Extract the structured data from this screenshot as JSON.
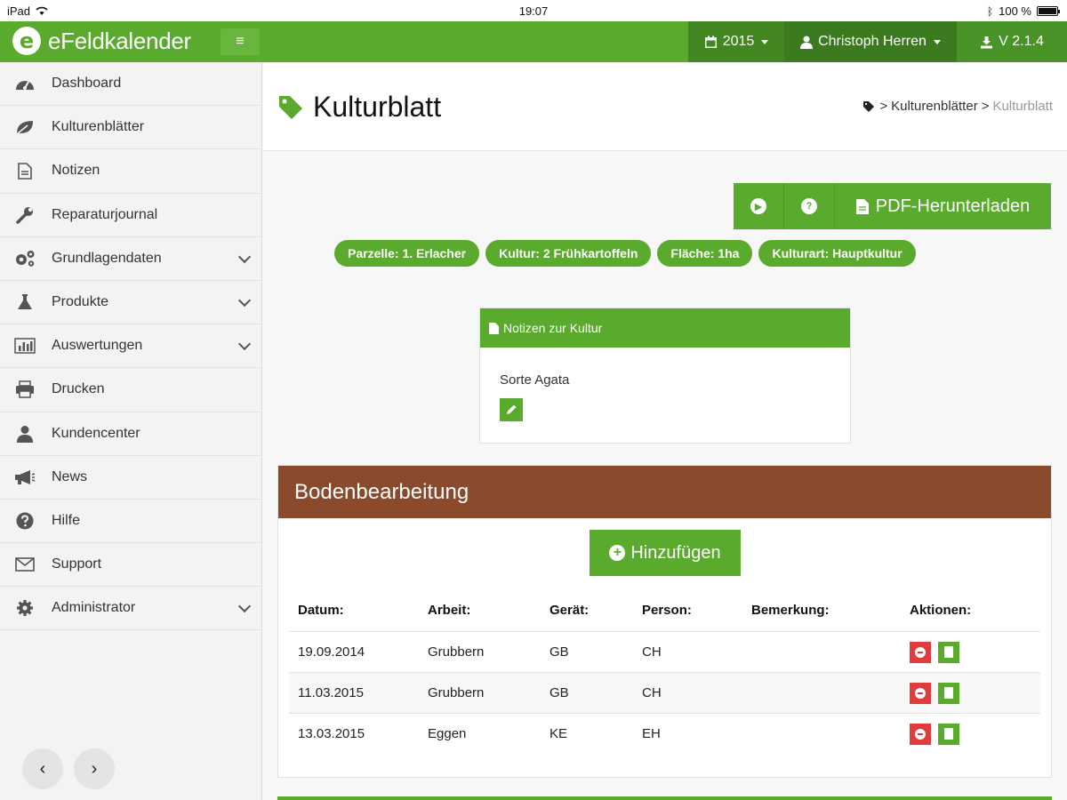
{
  "status_bar": {
    "device": "iPad",
    "time": "19:07",
    "battery": "100 %"
  },
  "topnav": {
    "brand": "eFeldkalender",
    "year": "2015",
    "user": "Christoph Herren",
    "version": "V 2.1.4"
  },
  "sidebar": {
    "items": [
      {
        "label": "Dashboard"
      },
      {
        "label": "Kulturenblätter"
      },
      {
        "label": "Notizen"
      },
      {
        "label": "Reparaturjournal"
      },
      {
        "label": "Grundlagendaten"
      },
      {
        "label": "Produkte"
      },
      {
        "label": "Auswertungen"
      },
      {
        "label": "Drucken"
      },
      {
        "label": "Kundencenter"
      },
      {
        "label": "News"
      },
      {
        "label": "Hilfe"
      },
      {
        "label": "Support"
      },
      {
        "label": "Administrator"
      }
    ]
  },
  "page": {
    "title": "Kulturblatt",
    "breadcrumb": {
      "parent": "Kulturenblätter",
      "current": "Kulturblatt"
    },
    "pdf_button": "PDF-Herunterladen",
    "badges": [
      "Parzelle: 1. Erlacher",
      "Kultur: 2 Frühkartoffeln",
      "Fläche: 1ha",
      "Kulturart: Hauptkultur"
    ],
    "notes": {
      "heading": "Notizen zur Kultur",
      "text": "Sorte Agata"
    },
    "section": {
      "title": "Bodenbearbeitung",
      "add_button": "Hinzufügen",
      "columns": [
        "Datum:",
        "Arbeit:",
        "Gerät:",
        "Person:",
        "Bemerkung:",
        "Aktionen:"
      ],
      "rows": [
        {
          "datum": "19.09.2014",
          "arbeit": "Grubbern",
          "geraet": "GB",
          "person": "CH",
          "bemerkung": ""
        },
        {
          "datum": "11.03.2015",
          "arbeit": "Grubbern",
          "geraet": "GB",
          "person": "CH",
          "bemerkung": ""
        },
        {
          "datum": "13.03.2015",
          "arbeit": "Eggen",
          "geraet": "KE",
          "person": "EH",
          "bemerkung": ""
        }
      ]
    }
  },
  "colors": {
    "brand_green": "#5aaa2e",
    "section_brown": "#8b4a2b",
    "delete_red": "#e23b3b"
  }
}
